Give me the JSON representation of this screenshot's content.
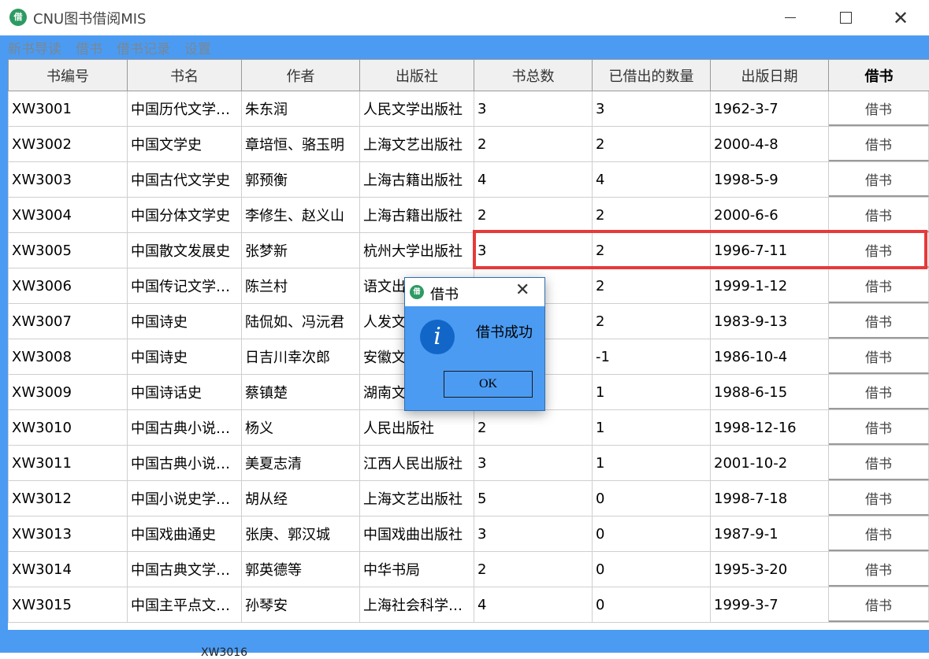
{
  "window": {
    "title": "CNU图书借阅MIS",
    "icon_text": "借",
    "minimize_icon": "minimize-icon",
    "maximize_icon": "maximize-icon",
    "close_glyph": "✕"
  },
  "menu": [
    "新书导读",
    "借书",
    "借书记录",
    "设置"
  ],
  "table": {
    "headers": [
      "书编号",
      "书名",
      "作者",
      "出版社",
      "书总数",
      "已借出的数量",
      "出版日期",
      "借书"
    ],
    "rows": [
      [
        "XW3001",
        "中国历代文学…",
        "朱东润",
        "人民文学出版社",
        "3",
        "3",
        "1962-3-7",
        "借书"
      ],
      [
        "XW3002",
        "中国文学史",
        "章培恒、骆玉明",
        "上海文艺出版社",
        "2",
        "2",
        "2000-4-8",
        "借书"
      ],
      [
        "XW3003",
        "中国古代文学史",
        "郭预衡",
        "上海古籍出版社",
        "4",
        "4",
        "1998-5-9",
        "借书"
      ],
      [
        "XW3004",
        "中国分体文学史",
        "李修生、赵义山",
        "上海古籍出版社",
        "2",
        "2",
        "2000-6-6",
        "借书"
      ],
      [
        "XW3005",
        "中国散文发展史",
        "张梦新",
        "杭州大学出版社",
        "3",
        "2",
        "1996-7-11",
        "借书"
      ],
      [
        "XW3006",
        "中国传记文学…",
        "陈兰村",
        "语文出",
        "",
        "2",
        "1999-1-12",
        "借书"
      ],
      [
        "XW3007",
        "中国诗史",
        "陆侃如、冯沅君",
        "人发文",
        "",
        "2",
        "1983-9-13",
        "借书"
      ],
      [
        "XW3008",
        "中国诗史",
        "日吉川幸次郎",
        "安徽文",
        "",
        "-1",
        "1986-10-4",
        "借书"
      ],
      [
        "XW3009",
        "中国诗话史",
        "蔡镇楚",
        "湖南文",
        "",
        "1",
        "1988-6-15",
        "借书"
      ],
      [
        "XW3010",
        "中国古典小说…",
        "杨义",
        "人民出版社",
        "2",
        "1",
        "1998-12-16",
        "借书"
      ],
      [
        "XW3011",
        "中国古典小说…",
        "美夏志清",
        "江西人民出版社",
        "3",
        "1",
        "2001-10-2",
        "借书"
      ],
      [
        "XW3012",
        "中国小说史学…",
        "胡从经",
        "上海文艺出版社",
        "5",
        "0",
        "1998-7-18",
        "借书"
      ],
      [
        "XW3013",
        "中国戏曲通史",
        "张庚、郭汉城",
        "中国戏曲出版社",
        "3",
        "0",
        "1987-9-1",
        "借书"
      ],
      [
        "XW3014",
        "中国古典文学…",
        "郭英德等",
        "中华书局",
        "2",
        "0",
        "1995-3-20",
        "借书"
      ],
      [
        "XW3015",
        "中国主平点文…",
        "孙琴安",
        "上海社会科学…",
        "4",
        "0",
        "1999-3-7",
        "借书"
      ]
    ]
  },
  "bottom_fragment": "XW3016",
  "dialog": {
    "title": "借书",
    "icon_text": "借",
    "close_glyph": "✕",
    "info_glyph": "i",
    "message": "借书成功",
    "ok_label": "OK"
  },
  "colors": {
    "accent": "#4c9bf2",
    "highlight": "#e63a3a",
    "info_icon": "#1166c8"
  }
}
